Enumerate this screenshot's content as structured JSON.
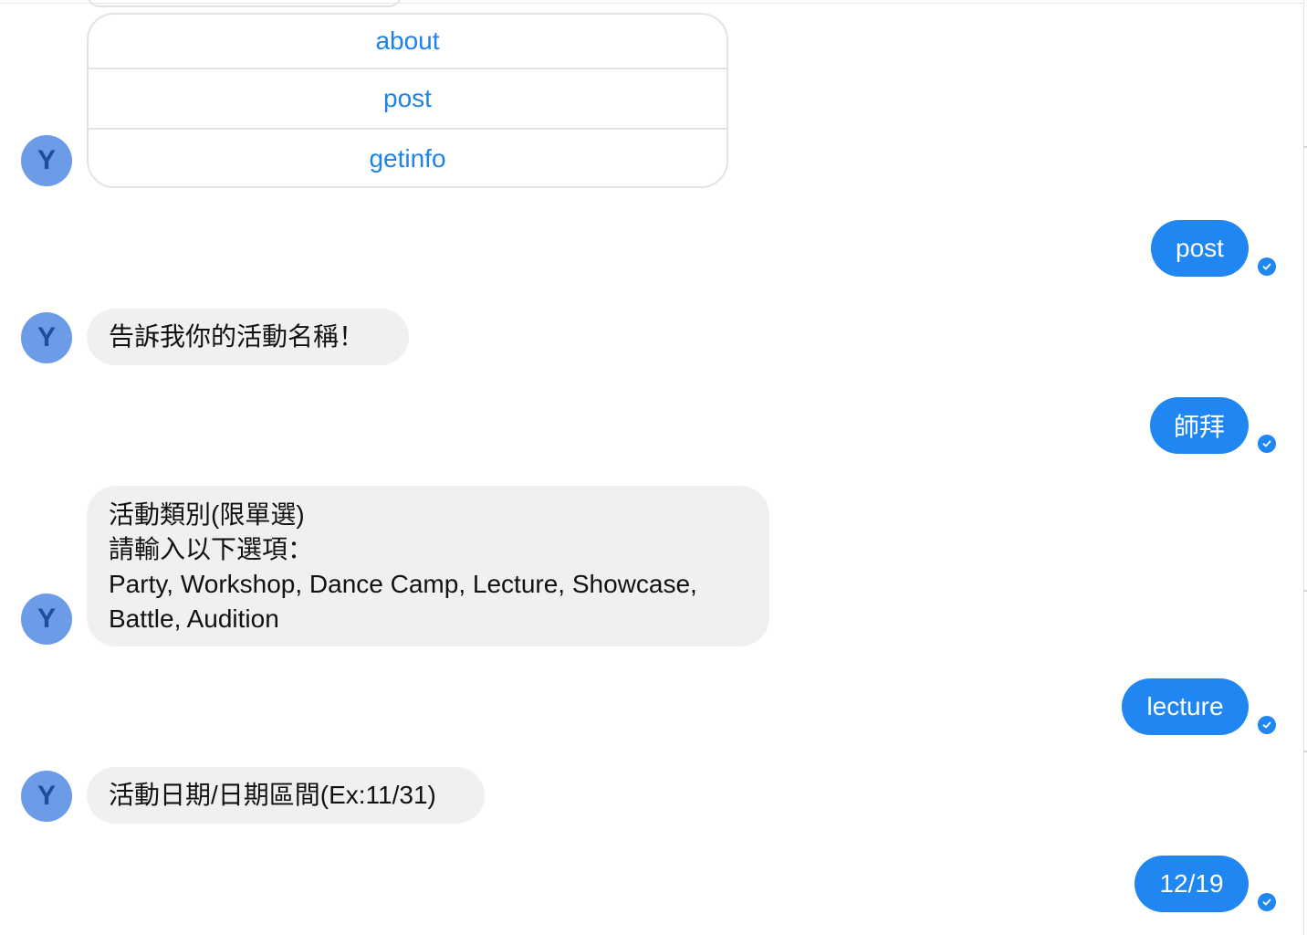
{
  "bot": {
    "avatar_letter": "Y"
  },
  "menu": {
    "options": [
      {
        "label": "about"
      },
      {
        "label": "post"
      },
      {
        "label": "getinfo"
      }
    ]
  },
  "messages": [
    {
      "sender": "user",
      "text": "post"
    },
    {
      "sender": "bot",
      "text": "告訴我你的活動名稱！"
    },
    {
      "sender": "user",
      "text": "師拜"
    },
    {
      "sender": "bot",
      "lines": [
        "活動類別(限單選)",
        "請輸入以下選項：",
        "Party, Workshop, Dance Camp, Lecture, Showcase,",
        "Battle, Audition"
      ]
    },
    {
      "sender": "user",
      "text": "lecture"
    },
    {
      "sender": "bot",
      "text": "活動日期/日期區間(Ex:11/31)"
    },
    {
      "sender": "user",
      "text": "12/19"
    }
  ],
  "colors": {
    "user_bubble": "#1f86f2",
    "bot_bubble": "#f0f0f0",
    "avatar": "#6c9ce8",
    "link": "#1f82e8"
  },
  "icons": {
    "seen": "check-circle-icon"
  }
}
